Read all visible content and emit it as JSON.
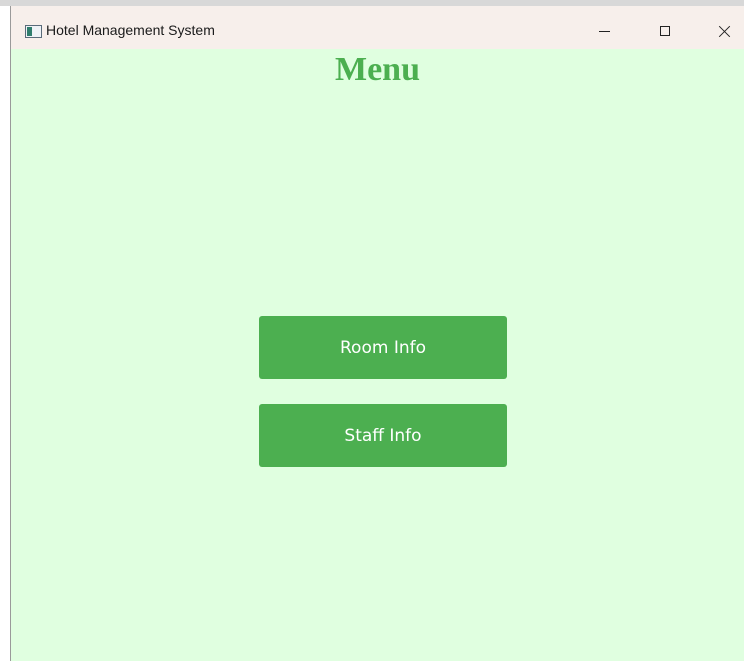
{
  "window": {
    "title": "Hotel Management System",
    "controls": {
      "minimize_icon": "minimize-icon",
      "maximize_icon": "maximize-icon",
      "close_icon": "close-icon"
    }
  },
  "main": {
    "heading": "Menu",
    "buttons": [
      {
        "label": "Room Info"
      },
      {
        "label": "Staff Info"
      }
    ]
  },
  "colors": {
    "background": "#e0ffe0",
    "accent": "#4caf50",
    "titlebar": "#f7efeb",
    "button_text": "#ffffff"
  }
}
